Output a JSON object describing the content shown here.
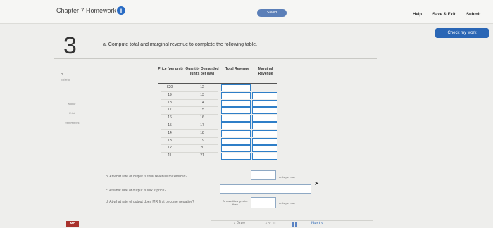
{
  "header": {
    "chapter_title": "Chapter 7 Homework",
    "info_icon": "i",
    "saved_label": "Saved",
    "help_label": "Help",
    "save_exit_label": "Save & Exit",
    "submit_label": "Submit",
    "check_label": "Check my work"
  },
  "question": {
    "number": "3",
    "points_value": "5",
    "points_label": "points",
    "side_links": [
      "eBook",
      "Print",
      "References"
    ],
    "prompt": "a. Compute total and marginal revenue to complete the following table."
  },
  "table": {
    "headers": {
      "price": "Price (per unit)",
      "quantity": "Quantity Demanded (units per day)",
      "total_revenue": "Total Revenue",
      "marginal_revenue": "Marginal Revenue"
    },
    "rows": [
      {
        "price": "$20",
        "quantity": "12"
      },
      {
        "price": "19",
        "quantity": "13"
      },
      {
        "price": "18",
        "quantity": "14"
      },
      {
        "price": "17",
        "quantity": "15"
      },
      {
        "price": "16",
        "quantity": "16"
      },
      {
        "price": "15",
        "quantity": "17"
      },
      {
        "price": "14",
        "quantity": "18"
      },
      {
        "price": "13",
        "quantity": "19"
      },
      {
        "price": "12",
        "quantity": "20"
      },
      {
        "price": "11",
        "quantity": "21"
      }
    ],
    "first_mr_placeholder": "–"
  },
  "subquestions": {
    "b": "b. At what rate of output is total revenue maximized?",
    "b_unit": "units per day",
    "c": "c. At what rate of output is MR < price?",
    "d": "d. At what rate of output does MR first become negative?",
    "d_qualifier": "At quantities greater than",
    "d_unit": "units per day"
  },
  "footer": {
    "prev_label": "‹ Prev",
    "page_indicator": "3 of 10",
    "next_label": "Next ›",
    "logo_text": "Mc"
  }
}
